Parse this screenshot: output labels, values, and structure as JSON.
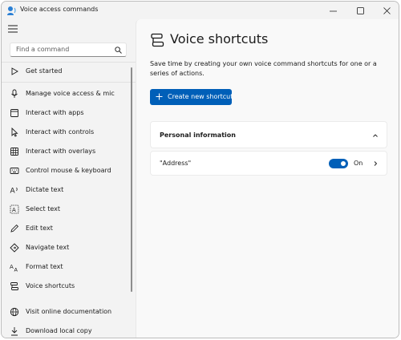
{
  "window": {
    "title": "Voice access commands"
  },
  "sidebar": {
    "search_placeholder": "Find a command",
    "items": [
      {
        "label": "Get started",
        "icon": "play-icon"
      },
      {
        "label": "Manage voice access & mic",
        "icon": "microphone-icon"
      },
      {
        "label": "Interact with apps",
        "icon": "apps-icon"
      },
      {
        "label": "Interact with controls",
        "icon": "pointer-icon"
      },
      {
        "label": "Interact with overlays",
        "icon": "grid-icon"
      },
      {
        "label": "Control mouse & keyboard",
        "icon": "keyboard-icon"
      },
      {
        "label": "Dictate text",
        "icon": "dictate-icon"
      },
      {
        "label": "Select text",
        "icon": "select-text-icon"
      },
      {
        "label": "Edit text",
        "icon": "edit-icon"
      },
      {
        "label": "Navigate text",
        "icon": "navigate-icon"
      },
      {
        "label": "Format text",
        "icon": "format-icon"
      },
      {
        "label": "Voice shortcuts",
        "icon": "shortcuts-icon"
      }
    ],
    "bottom_items": [
      {
        "label": "Visit online documentation",
        "icon": "globe-icon"
      },
      {
        "label": "Download local copy",
        "icon": "download-icon"
      }
    ]
  },
  "main": {
    "title": "Voice shortcuts",
    "description": "Save time by creating your own voice command shortcuts for one or a series of actions.",
    "create_button": "Create new shortcut",
    "section": {
      "title": "Personal information",
      "row": {
        "label": "\"Address\"",
        "toggle_label": "On",
        "toggle_on": true
      }
    }
  },
  "colors": {
    "accent": "#005fb8",
    "sidebar_bg": "#f3f3f3",
    "content_bg": "#f9f9f9"
  }
}
